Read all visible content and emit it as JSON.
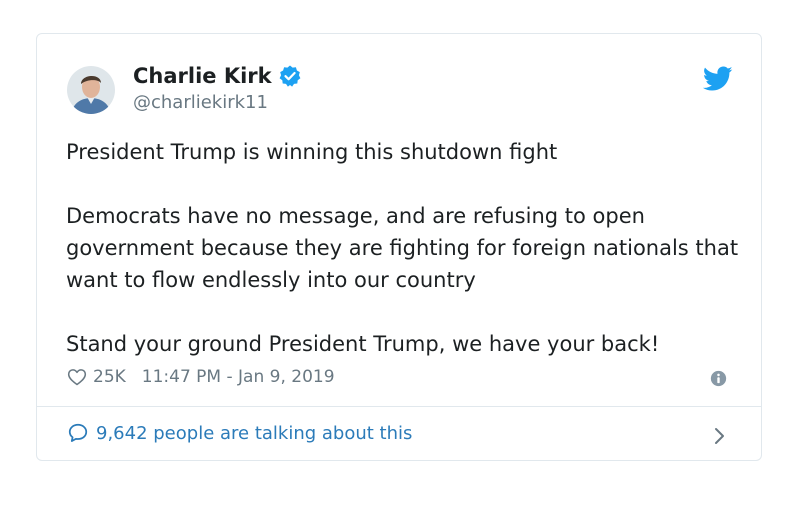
{
  "tweet": {
    "author_name": "Charlie Kirk",
    "handle": "@charliekirk11",
    "paragraphs": [
      "President Trump is winning this shutdown fight",
      "Democrats have no message, and are refusing to open government because they are fighting for foreign nationals that want to flow endlessly into our country",
      "Stand your ground President Trump, we have your back!"
    ],
    "likes": "25K",
    "timestamp": "11:47 PM - Jan 9, 2019",
    "conversation_label": "9,642 people are talking about this"
  },
  "icons": {
    "verified": "verified-badge-icon",
    "brand": "twitter-bird-icon",
    "like": "heart-icon",
    "info": "info-icon",
    "reply": "speech-bubble-icon",
    "chevron": "chevron-right-icon"
  },
  "colors": {
    "brand_blue": "#1da1f2",
    "link_blue": "#2b7bb9",
    "muted_text": "#697882",
    "border": "#e1e8ed"
  }
}
